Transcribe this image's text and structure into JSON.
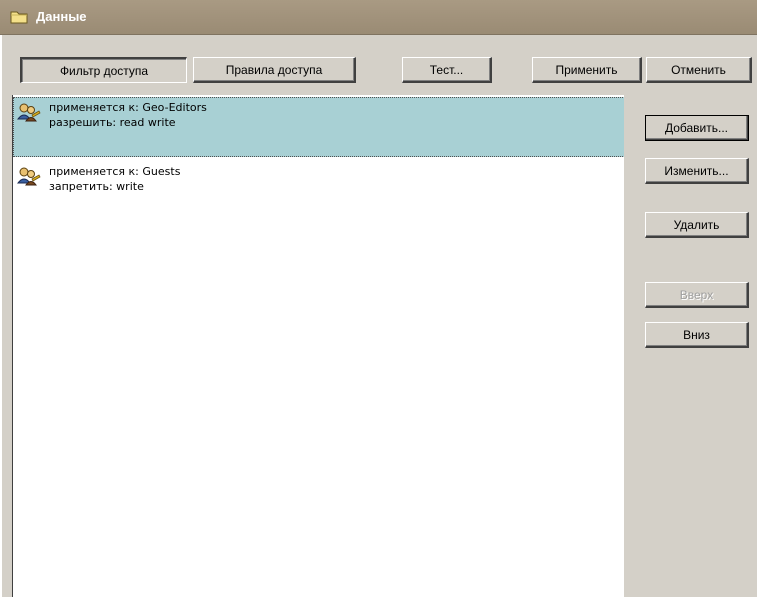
{
  "window": {
    "title": "Данные"
  },
  "toolbar": {
    "access_filter_label": "Фильтр доступа",
    "access_rules_label": "Правила доступа",
    "test_label": "Тест...",
    "apply_label": "Применить",
    "cancel_label": "Отменить"
  },
  "rules": [
    {
      "applies_to": "применяется к: Geo-Editors",
      "permission": "разрешить: read write",
      "selected": true,
      "icon": "users-key-icon"
    },
    {
      "applies_to": "применяется к: Guests",
      "permission": "запретить: write",
      "selected": false,
      "icon": "users-key-icon"
    }
  ],
  "side_buttons": {
    "add_label": "Добавить...",
    "edit_label": "Изменить...",
    "delete_label": "Удалить",
    "up_label": "Вверх",
    "down_label": "Вниз"
  },
  "colors": {
    "titlebar": "#9a8b74",
    "selection": "#a8d0d4",
    "face": "#d4d0c8"
  }
}
